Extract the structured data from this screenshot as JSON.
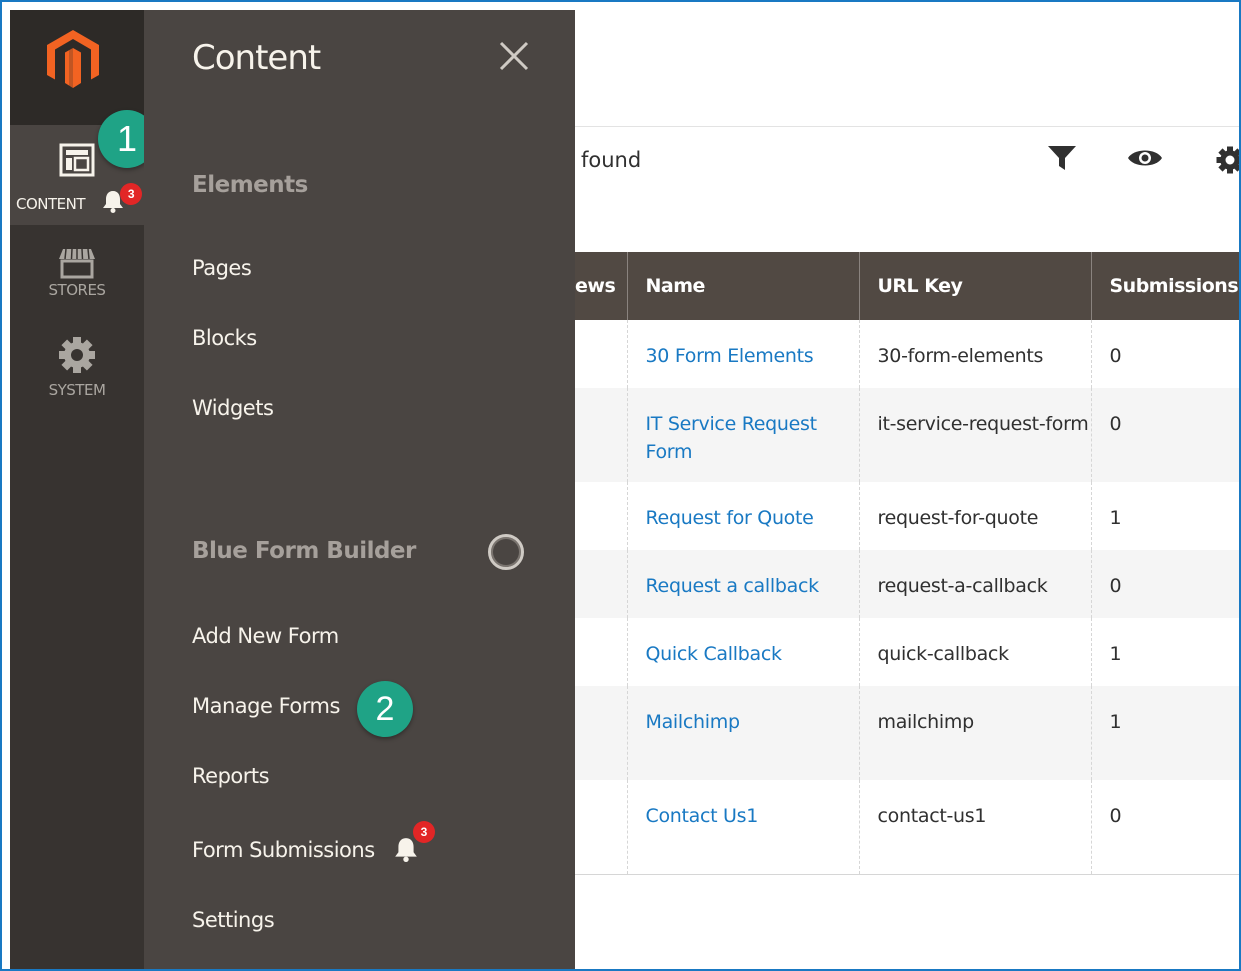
{
  "nav": {
    "items": [
      {
        "label": "CONTENT",
        "icon": "content-icon",
        "badge": "3",
        "active": true
      },
      {
        "label": "STORES",
        "icon": "stores-icon"
      },
      {
        "label": "SYSTEM",
        "icon": "gear-icon"
      }
    ]
  },
  "flyout": {
    "title": "Content",
    "sections": [
      {
        "title": "Elements",
        "links": [
          "Pages",
          "Blocks",
          "Widgets"
        ]
      },
      {
        "title": "Blue Form Builder",
        "links": [
          "Add New Form",
          "Manage Forms",
          "Reports",
          "Form Submissions",
          "Settings"
        ]
      }
    ],
    "submissions_badge": "3"
  },
  "callouts": {
    "step1": "1",
    "step2": "2"
  },
  "toolbar": {
    "found_text": "found"
  },
  "grid": {
    "columns": [
      "ews",
      "Name",
      "URL Key",
      "Submissions"
    ],
    "rows": [
      {
        "name": "30 Form Elements",
        "url_key": "30-form-elements",
        "submissions": "0"
      },
      {
        "name": "IT Service Request Form",
        "url_key": "it-service-request-form",
        "submissions": "0"
      },
      {
        "name": "Request for Quote",
        "url_key": "request-for-quote",
        "submissions": "1"
      },
      {
        "name": "Request a callback",
        "url_key": "request-a-callback",
        "submissions": "0"
      },
      {
        "name": "Quick Callback",
        "url_key": "quick-callback",
        "submissions": "1"
      },
      {
        "name": "Mailchimp",
        "url_key": "mailchimp",
        "submissions": "1"
      },
      {
        "name": "Contact Us1",
        "url_key": "contact-us1",
        "submissions": "0"
      }
    ]
  },
  "colors": {
    "nav_bg": "#373330",
    "flyout_bg": "#4a4542",
    "header_bg": "#514943",
    "link": "#1979c3",
    "callout": "#1fa386",
    "logo": "#f26322",
    "badge": "#e22626"
  }
}
